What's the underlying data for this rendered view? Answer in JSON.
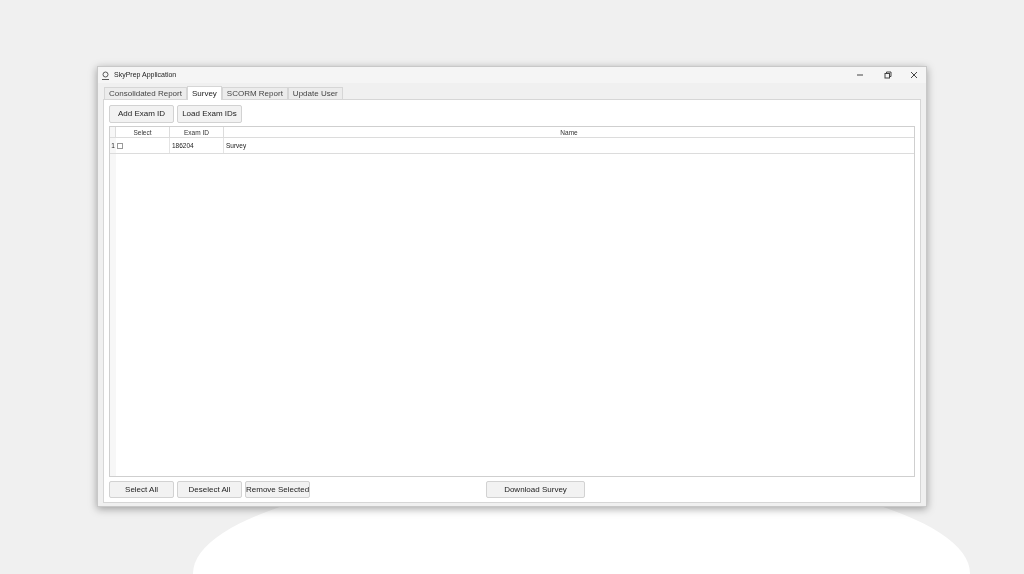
{
  "window": {
    "title": "SkyPrep Application"
  },
  "tabs": [
    {
      "label": "Consolidated Report",
      "selected": false
    },
    {
      "label": "Survey",
      "selected": true
    },
    {
      "label": "SCORM Report",
      "selected": false
    },
    {
      "label": "Update User",
      "selected": false
    }
  ],
  "toolbar_buttons": [
    "Add Exam ID",
    "Load Exam IDs"
  ],
  "table": {
    "columns": [
      "Select",
      "Exam ID",
      "Name"
    ],
    "rows": [
      {
        "row_number": "1",
        "checked": false,
        "exam_id": "186204",
        "name": "Survey"
      }
    ]
  },
  "bottom_buttons": [
    "Select All",
    "Deselect All",
    "Remove Selected"
  ],
  "download_button": "Download Survey"
}
